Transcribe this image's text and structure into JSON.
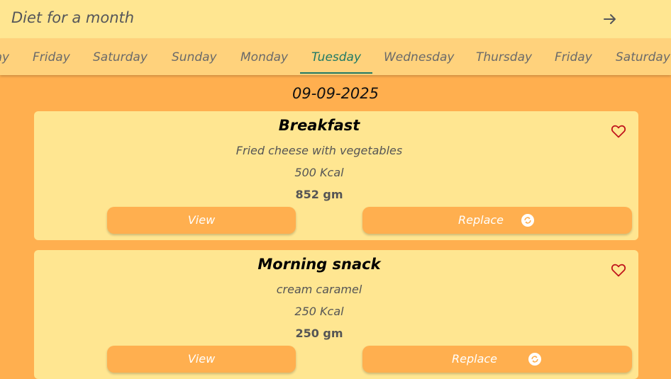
{
  "appbar": {
    "title": "Diet for a month",
    "arrow_icon": "arrow-right-icon"
  },
  "tabs": [
    {
      "label": "Thursday",
      "active": false
    },
    {
      "label": "Friday",
      "active": false
    },
    {
      "label": "Saturday",
      "active": false
    },
    {
      "label": "Sunday",
      "active": false
    },
    {
      "label": "Monday",
      "active": false
    },
    {
      "label": "Tuesday",
      "active": true
    },
    {
      "label": "Wednesday",
      "active": false
    },
    {
      "label": "Thursday",
      "active": false
    },
    {
      "label": "Friday",
      "active": false
    },
    {
      "label": "Saturday",
      "active": false
    }
  ],
  "date": "09-09-2025",
  "meals": [
    {
      "title": "Breakfast",
      "name": "Fried cheese with vegetables",
      "kcal": "500 Kcal",
      "weight": "852 gm",
      "view_label": "View",
      "replace_label": "Replace"
    },
    {
      "title": "Morning snack",
      "name": "cream caramel",
      "kcal": "250 Kcal",
      "weight": "250 gm",
      "view_label": "View",
      "replace_label": "Replace"
    }
  ],
  "colors": {
    "background": "#FFAF4F",
    "card": "#FFE691",
    "appbar": "#FFE691",
    "tabbar": "#FFD27C",
    "active_tab": "#1f7a66",
    "heart": "#c0141c"
  },
  "icons": {
    "favorite": "heart-outline-icon",
    "replace": "refresh-circle-icon"
  }
}
